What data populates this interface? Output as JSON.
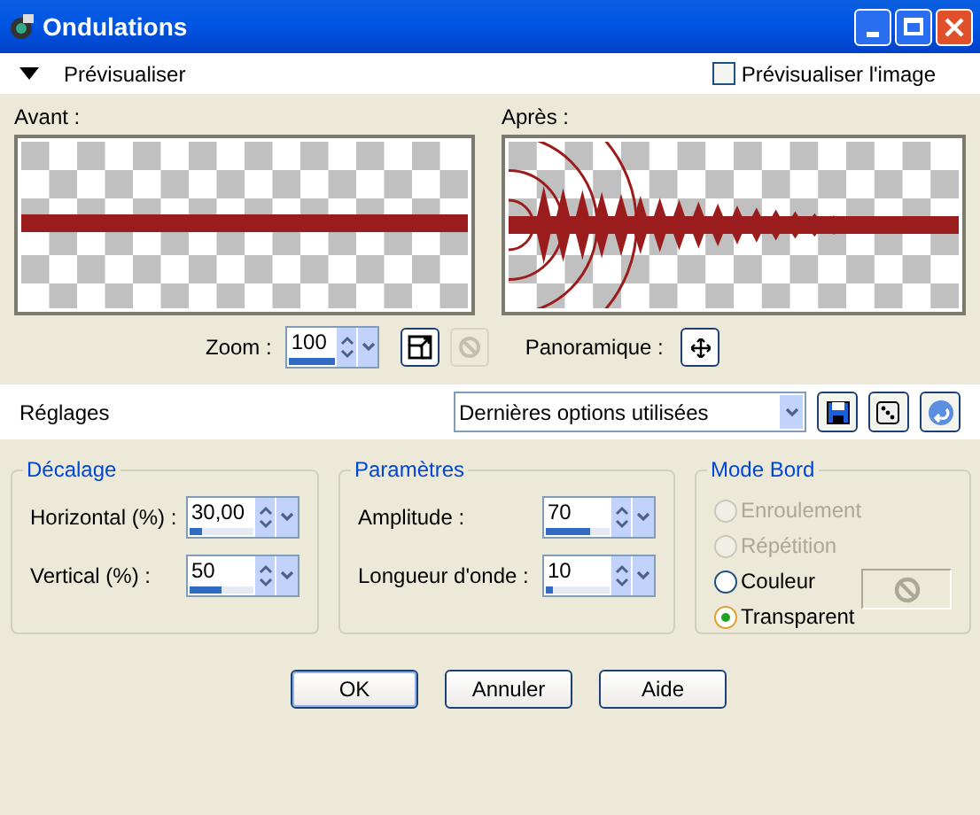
{
  "window": {
    "title": "Ondulations"
  },
  "preview_toggle": {
    "label": "Prévisualiser",
    "expanded": true
  },
  "preview_image": {
    "label": "Prévisualiser l'image",
    "checked": false
  },
  "before": {
    "label": "Avant :"
  },
  "after": {
    "label": "Après :"
  },
  "zoom": {
    "label": "Zoom :",
    "value": "100"
  },
  "pan": {
    "label": "Panoramique :"
  },
  "presets": {
    "label": "Réglages",
    "value": "Dernières options utilisées"
  },
  "offset": {
    "title": "Décalage",
    "fields": [
      {
        "label": "Horizontal (%) :",
        "value": "30,00",
        "level": 0.2
      },
      {
        "label": "Vertical (%) :",
        "value": "50",
        "level": 0.5
      }
    ]
  },
  "parameters": {
    "title": "Paramètres",
    "fields": [
      {
        "label": "Amplitude :",
        "value": "70",
        "level": 0.7
      },
      {
        "label": "Longueur d'onde :",
        "value": "10",
        "level": 0.1
      }
    ]
  },
  "edge_mode": {
    "title": "Mode Bord",
    "options": [
      {
        "label": "Enroulement",
        "selected": false,
        "disabled": true
      },
      {
        "label": "Répétition",
        "selected": false,
        "disabled": true
      },
      {
        "label": "Couleur",
        "selected": false,
        "disabled": false
      },
      {
        "label": "Transparent",
        "selected": true,
        "disabled": false
      }
    ]
  },
  "buttons": [
    "OK",
    "Annuler",
    "Aide"
  ]
}
